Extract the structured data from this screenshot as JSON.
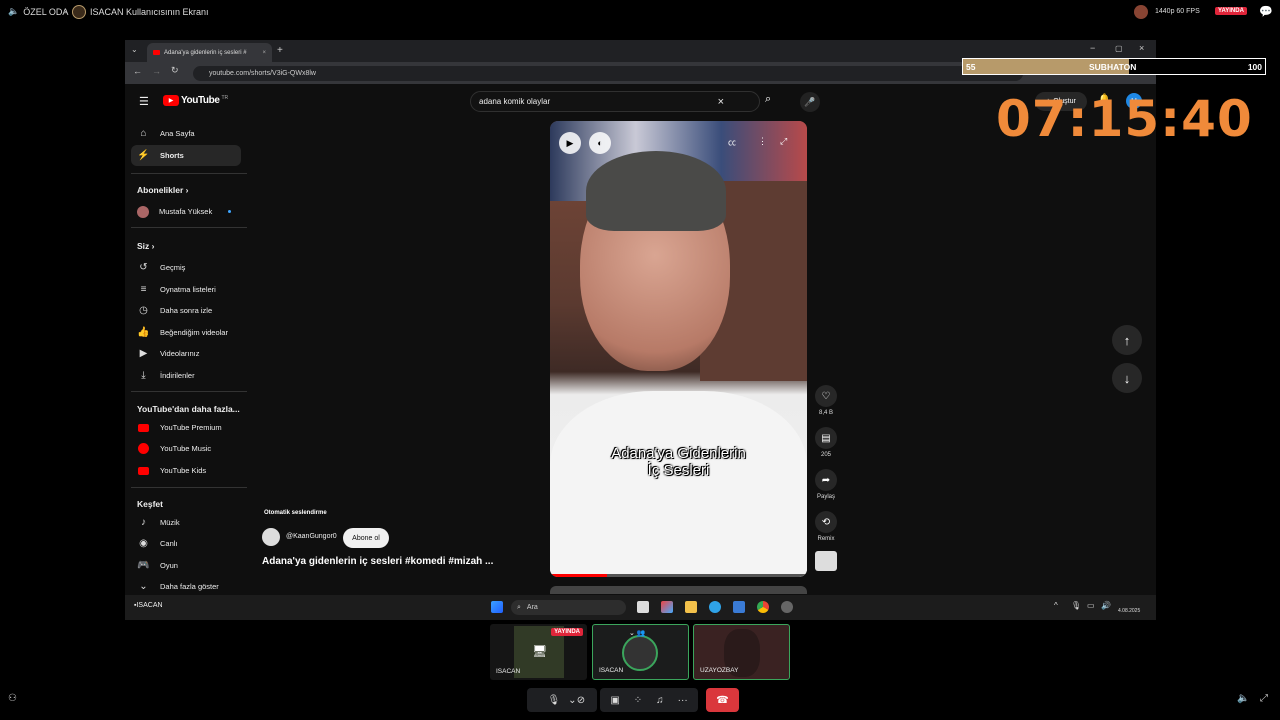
{
  "top": {
    "room_label": "ÖZEL ODA",
    "separator": "·",
    "screen_label": "ISACAN Kullanıcısının Ekranı",
    "quality": "1440p 60 FPS",
    "live_badge": "YAYINDA"
  },
  "browser": {
    "tab_title": "Adana'ya gidenlerin iç sesleri #",
    "url": "youtube.com/shorts/V3iG-QWx8lw",
    "new_tab": "+"
  },
  "youtube": {
    "logo": "YouTube",
    "logo_region": "TR",
    "search_query": "adana komik olaylar",
    "create_label": "Oluştur",
    "avatar_letter": "H",
    "sidebar": {
      "main": [
        {
          "label": "Ana Sayfa",
          "icon": "home-icon"
        },
        {
          "label": "Shorts",
          "icon": "shorts-icon"
        }
      ],
      "subs_title": "Abonelikler",
      "subs": [
        {
          "label": "Mustafa Yüksek"
        }
      ],
      "you_title": "Siz",
      "you": [
        {
          "label": "Geçmiş",
          "icon": "history-icon"
        },
        {
          "label": "Oynatma listeleri",
          "icon": "playlist-icon"
        },
        {
          "label": "Daha sonra izle",
          "icon": "clock-icon"
        },
        {
          "label": "Beğendiğim videolar",
          "icon": "thumb-up-icon"
        },
        {
          "label": "Videolarınız",
          "icon": "video-icon"
        },
        {
          "label": "İndirilenler",
          "icon": "download-icon"
        }
      ],
      "more_title": "YouTube'dan daha fazla...",
      "more": [
        {
          "label": "YouTube Premium"
        },
        {
          "label": "YouTube Music"
        },
        {
          "label": "YouTube Kids"
        }
      ],
      "explore_title": "Keşfet",
      "explore": [
        {
          "label": "Müzik",
          "icon": "music-icon"
        },
        {
          "label": "Canlı",
          "icon": "live-icon"
        },
        {
          "label": "Oyun",
          "icon": "game-icon"
        },
        {
          "label": "Daha fazla göster",
          "icon": "chevron-down-icon"
        }
      ]
    },
    "short": {
      "caption_line1": "Adana'ya Gidenlerin",
      "caption_line2": "İç Sesleri",
      "autodub": "Otomatik seslendirme",
      "channel": "@KaanGungor0",
      "subscribe": "Abone ol",
      "title": "Adana'ya gidenlerin iç sesleri #komedi #mizah ...",
      "likes": "8,4 B",
      "comments": "205",
      "share": "Paylaş",
      "remix": "Remix"
    }
  },
  "overlay": {
    "sub_current": "55",
    "sub_title": "SUBHATON",
    "sub_goal": "100",
    "sub_progress": 0.55,
    "timer": "07:15:40"
  },
  "taskbar": {
    "search_placeholder": "Ara",
    "user": "ISACAN",
    "date": "4.08.2025"
  },
  "participants": [
    {
      "name": "ISACAN",
      "badge": "YAYINDA"
    },
    {
      "name": "ISACAN"
    },
    {
      "name": "UZAYOZBAY"
    }
  ]
}
